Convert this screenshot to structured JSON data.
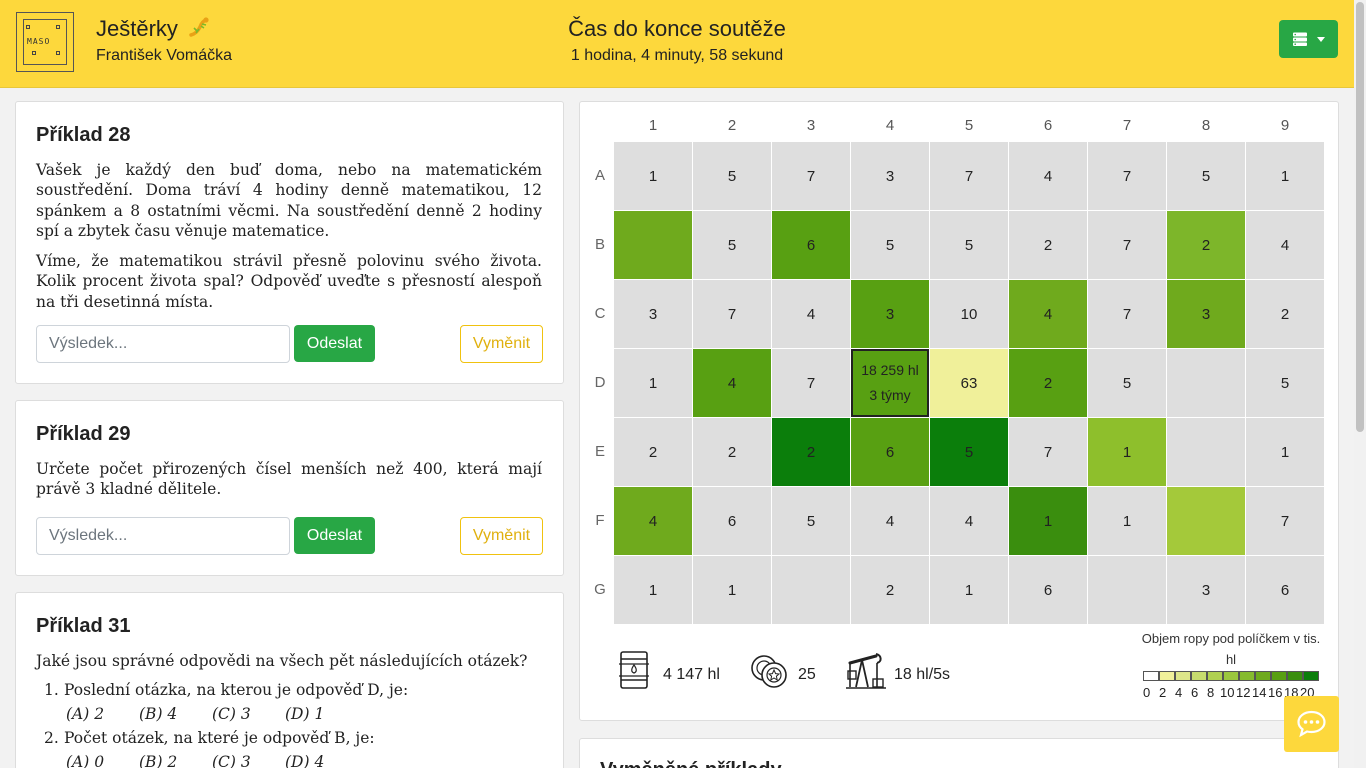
{
  "header": {
    "team_name": "Ještěrky",
    "player_name": "František Vomáčka",
    "timer_title": "Čas do konce soutěže",
    "timer_value": "1 hodina, 4 minuty, 58 sekund",
    "logo_text": "MASO"
  },
  "problems": [
    {
      "title": "Příklad 28",
      "paragraphs": [
        "Vašek je každý den buď doma, nebo na matematickém soustředění. Doma tráví 4 hodiny denně matematikou, 12 spánkem a 8 ostatními věcmi. Na soustředění denně 2 hodiny spí a zbytek času věnuje matematice.",
        "Víme, že matematikou strávil přesně polovinu svého života. Kolik procent života spal? Odpověď uveďte s přesností alespoň na tři desetinná místa."
      ],
      "placeholder": "Výsledek...",
      "send_label": "Odeslat",
      "swap_label": "Vyměnit"
    },
    {
      "title": "Příklad 29",
      "paragraphs": [
        "Určete počet přirozených čísel menších než 400, která mají právě 3 kladné dělitele."
      ],
      "placeholder": "Výsledek...",
      "send_label": "Odeslat",
      "swap_label": "Vyměnit"
    },
    {
      "title": "Příklad 31",
      "intro": "Jaké jsou správné odpovědi na všech pět následujících otázek?",
      "questions": [
        {
          "num": "1.",
          "text": "Poslední otázka, na kterou je odpověď D, je:",
          "options": [
            "(A) 2",
            "(B) 4",
            "(C) 3",
            "(D) 1"
          ]
        },
        {
          "num": "2.",
          "text": "Počet otázek, na které je odpověď B, je:",
          "options": [
            "(A) 0",
            "(B) 2",
            "(C) 3",
            "(D) 4"
          ]
        }
      ]
    }
  ],
  "map": {
    "columns": [
      "1",
      "2",
      "3",
      "4",
      "5",
      "6",
      "7",
      "8",
      "9"
    ],
    "rows": [
      "A",
      "B",
      "C",
      "D",
      "E",
      "F",
      "G"
    ],
    "cells": [
      [
        "1",
        "5",
        "7",
        "3",
        "7",
        "4",
        "7",
        "5",
        "1"
      ],
      [
        "",
        "5",
        "6",
        "5",
        "5",
        "2",
        "7",
        "2",
        "4"
      ],
      [
        "3",
        "7",
        "4",
        "3",
        "10",
        "4",
        "7",
        "3",
        "2"
      ],
      [
        "1",
        "4",
        "7",
        "18 259 hl|3 týmy",
        "63",
        "2",
        "5",
        "",
        "5"
      ],
      [
        "2",
        "2",
        "2",
        "6",
        "5",
        "7",
        "1",
        "",
        "1"
      ],
      [
        "4",
        "6",
        "5",
        "4",
        "4",
        "1",
        "1",
        "",
        "7"
      ],
      [
        "1",
        "1",
        "",
        "2",
        "1",
        "6",
        "",
        "3",
        "6"
      ]
    ],
    "cell_colors": [
      [
        "#dedede",
        "#dedede",
        "#dedede",
        "#dedede",
        "#dedede",
        "#dedede",
        "#dedede",
        "#dedede",
        "#dedede"
      ],
      [
        "#6faa1d",
        "#dedede",
        "#58a012",
        "#dedede",
        "#dedede",
        "#dedede",
        "#dedede",
        "#7db62a",
        "#dedede"
      ],
      [
        "#dedede",
        "#dedede",
        "#dedede",
        "#58a012",
        "#dedede",
        "#6faa1d",
        "#dedede",
        "#6faa1d",
        "#dedede"
      ],
      [
        "#dedede",
        "#58a012",
        "#dedede",
        "#58a012",
        "#f0f09a",
        "#58a012",
        "#dedede",
        "#dedede",
        "#dedede"
      ],
      [
        "#dedede",
        "#dedede",
        "#0b7e0b",
        "#58a012",
        "#0b7e0b",
        "#dedede",
        "#8ebf2c",
        "#dedede",
        "#dedede"
      ],
      [
        "#6faa1d",
        "#dedede",
        "#dedede",
        "#dedede",
        "#dedede",
        "#3a8e0e",
        "#dedede",
        "#a4c93a",
        "#dedede"
      ],
      [
        "#dedede",
        "#dedede",
        "#dedede",
        "#dedede",
        "#dedede",
        "#dedede",
        "#dedede",
        "#dedede",
        "#dedede"
      ]
    ],
    "highlighted_cell": "D4",
    "stats": {
      "oil": "4 147 hl",
      "coins": "25",
      "rate": "18 hl/5s"
    },
    "legend": {
      "title": "Objem ropy pod políčkem v tis. hl",
      "ticks": [
        "0",
        "2",
        "4",
        "6",
        "8",
        "10",
        "12",
        "14",
        "16",
        "18",
        "20"
      ],
      "colors": [
        "#ffffff",
        "#f0f09a",
        "#dde68a",
        "#c7dc6e",
        "#b0d050",
        "#9bc73e",
        "#86bb2e",
        "#6faa1d",
        "#58a012",
        "#3a8e0e",
        "#0b7e0b"
      ]
    }
  },
  "exchanged": {
    "title": "Vyměněné příklady"
  },
  "icons": {
    "menu": "server-icon",
    "chat": "chat-icon",
    "oil": "barrel-icon",
    "coins": "coins-icon",
    "rate": "pumpjack-icon"
  }
}
